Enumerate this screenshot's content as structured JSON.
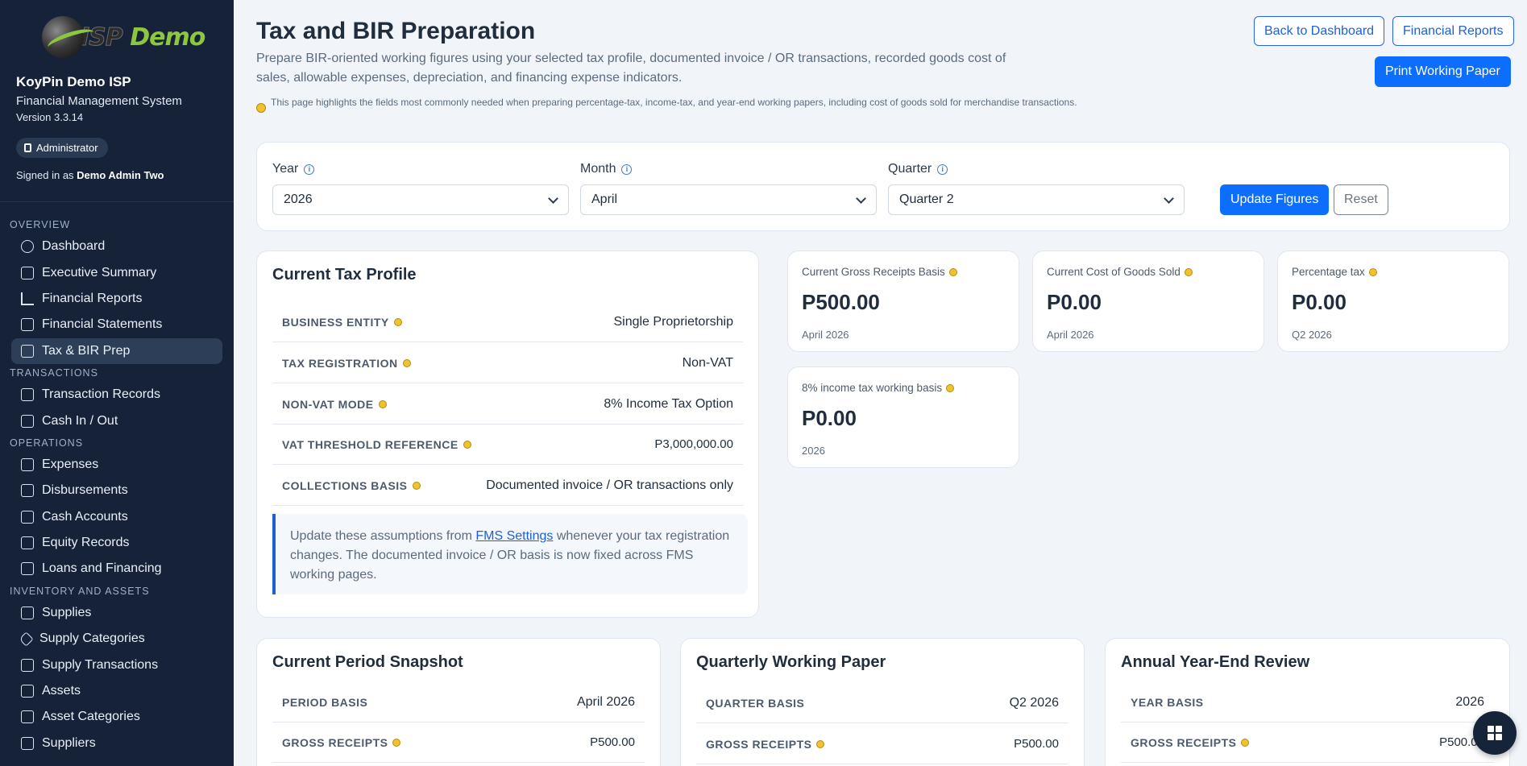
{
  "brand": {
    "logo_text_1": "ISP",
    "logo_text_2": " Demo",
    "org_name": "KoyPin Demo ISP",
    "system_name": "Financial Management System",
    "version": "Version 3.3.14",
    "role": "Administrator",
    "signed_in_prefix": "Signed in as ",
    "user": "Demo Admin Two"
  },
  "nav": {
    "sections": [
      {
        "label": "OVERVIEW",
        "items": [
          "Dashboard",
          "Executive Summary",
          "Financial Reports",
          "Financial Statements",
          "Tax & BIR Prep"
        ]
      },
      {
        "label": "TRANSACTIONS",
        "items": [
          "Transaction Records",
          "Cash In / Out"
        ]
      },
      {
        "label": "OPERATIONS",
        "items": [
          "Expenses",
          "Disbursements",
          "Cash Accounts",
          "Equity Records",
          "Loans and Financing"
        ]
      },
      {
        "label": "INVENTORY AND ASSETS",
        "items": [
          "Supplies",
          "Supply Categories",
          "Supply Transactions",
          "Assets",
          "Asset Categories",
          "Suppliers"
        ]
      }
    ],
    "active": "Tax & BIR Prep"
  },
  "header": {
    "title": "Tax and BIR Preparation",
    "description": "Prepare BIR-oriented working figures using your selected tax profile, documented invoice / OR transactions, recorded goods cost of sales, allowable expenses, depreciation, and financing expense indicators.",
    "note": "This page highlights the fields most commonly needed when preparing percentage-tax, income-tax, and year-end working papers, including cost of goods sold for merchandise transactions.",
    "back_button": "Back to Dashboard",
    "reports_button": "Financial Reports",
    "print_button": "Print Working Paper"
  },
  "filters": {
    "year_label": "Year",
    "year_value": "2026",
    "month_label": "Month",
    "month_value": "April",
    "quarter_label": "Quarter",
    "quarter_value": "Quarter 2",
    "update_button": "Update Figures",
    "reset_button": "Reset"
  },
  "tax_profile": {
    "title": "Current Tax Profile",
    "rows": [
      {
        "key": "BUSINESS ENTITY",
        "value": "Single Proprietorship"
      },
      {
        "key": "TAX REGISTRATION",
        "value": "Non-VAT"
      },
      {
        "key": "NON-VAT MODE",
        "value": "8% Income Tax Option"
      },
      {
        "key": "VAT THRESHOLD REFERENCE",
        "value": "P3,000,000.00"
      },
      {
        "key": "COLLECTIONS BASIS",
        "value": "Documented invoice / OR transactions only"
      }
    ],
    "callout_pre": "Update these assumptions from ",
    "callout_link": "FMS Settings",
    "callout_post": " whenever your tax registration changes. The documented invoice / OR basis is now fixed across FMS working pages."
  },
  "stats": [
    {
      "label": "Current Gross Receipts Basis",
      "value": "P500.00",
      "sub": "April 2026"
    },
    {
      "label": "Current Cost of Goods Sold",
      "value": "P0.00",
      "sub": "April 2026"
    },
    {
      "label": "Percentage tax",
      "value": "P0.00",
      "sub": "Q2 2026"
    },
    {
      "label": "8% income tax working basis",
      "value": "P0.00",
      "sub": "2026"
    }
  ],
  "panels": [
    {
      "title": "Current Period Snapshot",
      "rows": [
        {
          "key": "PERIOD BASIS",
          "value": "April 2026"
        },
        {
          "key": "GROSS RECEIPTS",
          "value": "P500.00"
        }
      ]
    },
    {
      "title": "Quarterly Working Paper",
      "rows": [
        {
          "key": "QUARTER BASIS",
          "value": "Q2 2026"
        },
        {
          "key": "GROSS RECEIPTS",
          "value": "P500.00"
        }
      ]
    },
    {
      "title": "Annual Year-End Review",
      "rows": [
        {
          "key": "YEAR BASIS",
          "value": "2026"
        },
        {
          "key": "GROSS RECEIPTS",
          "value": "P500.00"
        }
      ]
    }
  ],
  "colors": {
    "sidebar": "#152238",
    "accent": "#0d6efd",
    "logo_green": "#8dc63f"
  },
  "icons": {
    "info": "info-icon",
    "hint": "bulb-icon",
    "fab": "grid-icon"
  }
}
